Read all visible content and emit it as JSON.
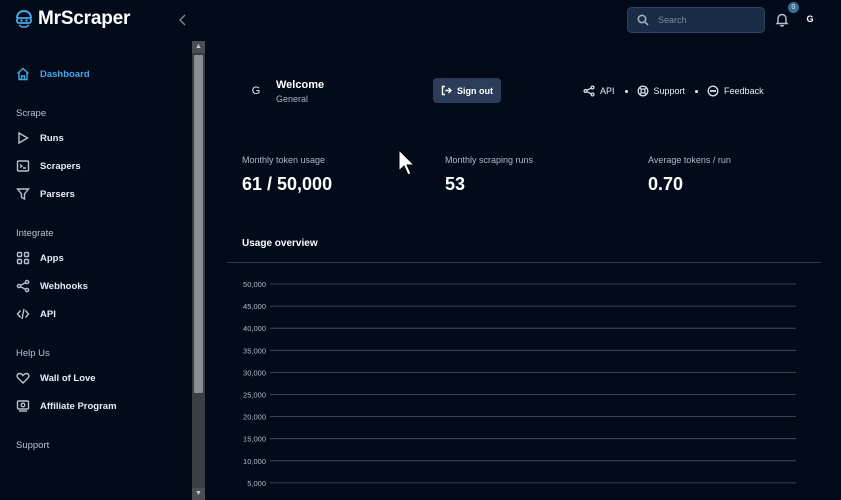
{
  "brand": {
    "name": "MrScraper"
  },
  "sidebar": {
    "dashboard": "Dashboard",
    "sections": [
      {
        "label": "Scrape",
        "items": [
          "Runs",
          "Scrapers",
          "Parsers"
        ]
      },
      {
        "label": "Integrate",
        "items": [
          "Apps",
          "Webhooks",
          "API"
        ]
      },
      {
        "label": "Help Us",
        "items": [
          "Wall of Love",
          "Affiliate Program"
        ]
      },
      {
        "label": "Support",
        "items": []
      }
    ]
  },
  "topbar": {
    "search_placeholder": "Search",
    "notification_count": "0",
    "user_initial": "G"
  },
  "welcome": {
    "initial": "G",
    "title": "Welcome",
    "subtitle": "General",
    "signout_label": "Sign out"
  },
  "links": {
    "api": "API",
    "support": "Support",
    "feedback": "Feedback"
  },
  "stats": [
    {
      "label": "Monthly token usage",
      "value": "61 / 50,000"
    },
    {
      "label": "Monthly scraping runs",
      "value": "53"
    },
    {
      "label": "Average tokens / run",
      "value": "0.70"
    }
  ],
  "usage": {
    "title": "Usage overview"
  },
  "chart_data": {
    "type": "line",
    "title": "",
    "xlabel": "",
    "ylabel": "",
    "ylim": [
      0,
      50000
    ],
    "ytick_labels": [
      "50,000",
      "45,000",
      "40,000",
      "35,000",
      "30,000",
      "25,000",
      "20,000",
      "15,000",
      "10,000",
      "5,000"
    ],
    "grid": true,
    "series": []
  },
  "colors": {
    "accent": "#45a7e8",
    "background": "#030b1a",
    "button": "#2b3d58"
  }
}
